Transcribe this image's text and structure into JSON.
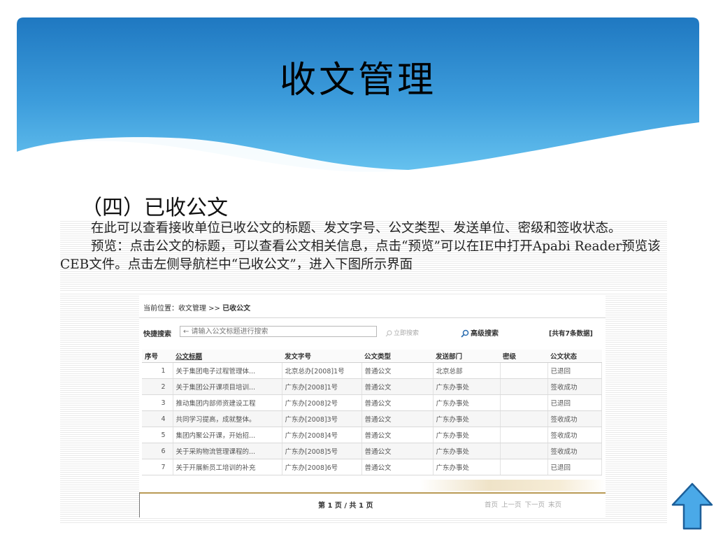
{
  "slide": {
    "title": "收文管理",
    "section": "（四）已收公文",
    "paragraph1": "在此可以查看接收单位已收公文的标题、发文字号、公文类型、发送单位、密级和签收状态。",
    "paragraph2": "预览：点击公文的标题，可以查看公文相关信息，点击“预览”可以在IE中打开Apabi Reader预览该CEB文件。点击左侧导航栏中“已收公文”，进入下图所示界面"
  },
  "colors": {
    "banner_dark": "#1a6fb8",
    "banner_light": "#5fbdef",
    "arrow_fill": "#4aa9e8",
    "arrow_stroke": "#1d5f99"
  },
  "app": {
    "breadcrumb_prefix": "当前位置：收文管理 >> ",
    "breadcrumb_current": "已收公文",
    "search_label": "快捷搜索",
    "search_placeholder": "← 请输入公文标题进行搜索",
    "search_button": "立即搜索",
    "advanced_button": "高级搜索",
    "total_count": "[共有7条数据]",
    "columns": [
      "序号",
      "公文标题",
      "发文字号",
      "公文类型",
      "发送部门",
      "密级",
      "公文状态"
    ],
    "rows": [
      {
        "no": "1",
        "title": "关于集团电子过程管理体...",
        "number": "北京总办[2008]1号",
        "type": "普通公文",
        "dept": "北京总部",
        "secret": "",
        "status": "已退回"
      },
      {
        "no": "2",
        "title": "关于集团公开课项目培训...",
        "number": "广东办[2008]1号",
        "type": "普通公文",
        "dept": "广东办事处",
        "secret": "",
        "status": "签收成功"
      },
      {
        "no": "3",
        "title": "推动集团内部师资建设工程",
        "number": "广东办[2008]2号",
        "type": "普通公文",
        "dept": "广东办事处",
        "secret": "",
        "status": "已退回"
      },
      {
        "no": "4",
        "title": "共同学习提高，成就整体。",
        "number": "广东办[2008]3号",
        "type": "普通公文",
        "dept": "广东办事处",
        "secret": "",
        "status": "签收成功"
      },
      {
        "no": "5",
        "title": "集团内聚公开课，开始招...",
        "number": "广东办[2008]4号",
        "type": "普通公文",
        "dept": "广东办事处",
        "secret": "",
        "status": "签收成功"
      },
      {
        "no": "6",
        "title": "关于采购物流管理课程的...",
        "number": "广东办[2008]5号",
        "type": "普通公文",
        "dept": "广东办事处",
        "secret": "",
        "status": "签收成功"
      },
      {
        "no": "7",
        "title": "关于开展新员工培训的补充",
        "number": "广东办[2008]6号",
        "type": "普通公文",
        "dept": "广东办事处",
        "secret": "",
        "status": "已退回"
      }
    ],
    "pager": "第 1 页 / 共 1 页",
    "pager_links": "首页 上一页 下一页 末页"
  }
}
